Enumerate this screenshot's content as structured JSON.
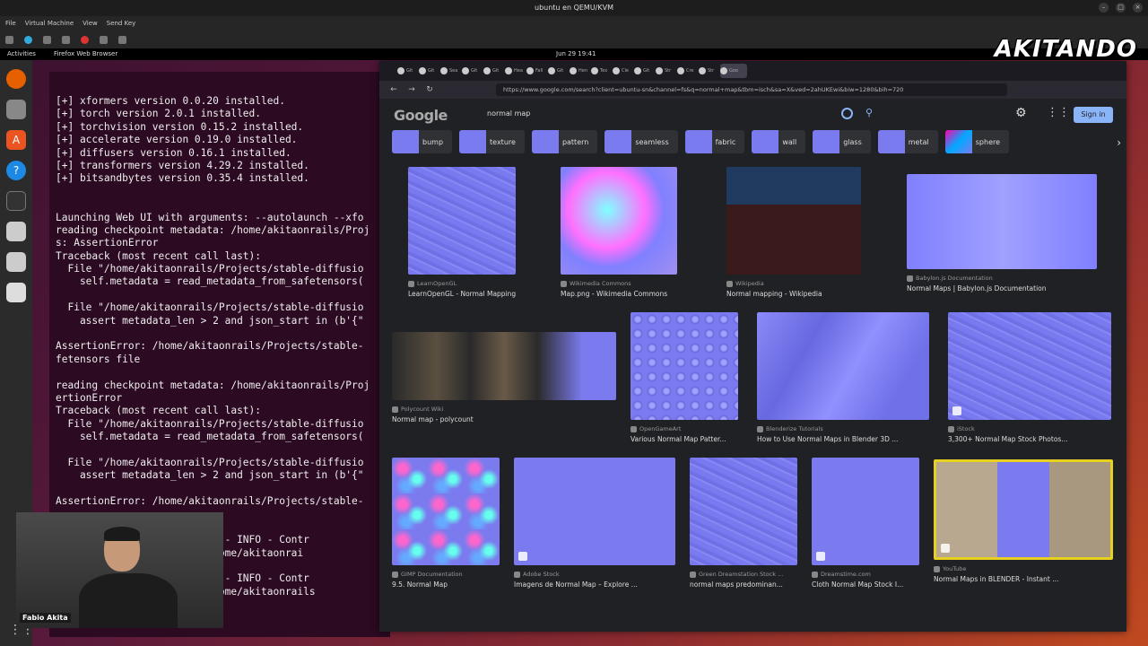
{
  "vm": {
    "title": "ubuntu en QEMU/KVM",
    "menu": [
      "File",
      "Virtual Machine",
      "View",
      "Send Key"
    ]
  },
  "topbar": {
    "activities": "Activities",
    "app": "Firefox Web Browser",
    "clock": "Jun 29  19:41"
  },
  "logo": "AKITANDO",
  "webcam": {
    "name": "Fabio Akita"
  },
  "terminal": {
    "lines": [
      "[+] xformers version 0.0.20 installed.",
      "[+] torch version 2.0.1 installed.",
      "[+] torchvision version 0.15.2 installed.",
      "[+] accelerate version 0.19.0 installed.",
      "[+] diffusers version 0.16.1 installed.",
      "[+] transformers version 4.29.2 installed.",
      "[+] bitsandbytes version 0.35.4 installed.",
      "",
      "",
      "Launching Web UI with arguments: --autolaunch --xfo",
      "reading checkpoint metadata: /home/akitaonrails/Proj",
      "s: AssertionError",
      "Traceback (most recent call last):",
      "  File \"/home/akitaonrails/Projects/stable-diffusio",
      "    self.metadata = read_metadata_from_safetensors(",
      "",
      "  File \"/home/akitaonrails/Projects/stable-diffusio",
      "    assert metadata_len > 2 and json_start in (b'{\"",
      "",
      "AssertionError: /home/akitaonrails/Projects/stable-",
      "fetensors file",
      "",
      "reading checkpoint metadata: /home/akitaonrails/Proj",
      "ertionError",
      "Traceback (most recent call last):",
      "  File \"/home/akitaonrails/Projects/stable-diffusio",
      "    self.metadata = read_metadata_from_safetensors(",
      "",
      "  File \"/home/akitaonrails/Projects/stable-diffusio",
      "    assert metadata_len > 2 and json_start in (b'{\"",
      "",
      "AssertionError: /home/akitaonrails/Projects/stable-",
      "",
      "",
      "                  ontrolNet - INFO - Contr",
      "                  ation: /home/akitaonrai",
      "",
      "                  ontrolNet - INFO - Contr",
      "                  ] from /home/akitaonrails"
    ]
  },
  "browser": {
    "url": "https://www.google.com/search?client=ubuntu-sn&channel=fs&q=normal+map&tbm=isch&sa=X&ved=2ahUKEwi&biw=1280&bih=720",
    "tabs": [
      "Git",
      "Git",
      "Sea",
      "Git",
      "Git",
      "Hea",
      "Fall",
      "Git",
      "Hen",
      "Tex",
      "Cle",
      "Git",
      "Str",
      "Cre",
      "Str",
      "Goo"
    ],
    "google": {
      "logo": "Google",
      "query": "normal map",
      "sign_in": "Sign in"
    },
    "chips": [
      "bump",
      "texture",
      "pattern",
      "seamless",
      "fabric",
      "wall",
      "glass",
      "metal",
      "sphere"
    ],
    "results": [
      {
        "source": "LearnOpenGL",
        "title": "LearnOpenGL - Normal Mapping"
      },
      {
        "source": "Wikimedia Commons",
        "title": "Map.png - Wikimedia Commons"
      },
      {
        "source": "Wikipedia",
        "title": "Normal mapping - Wikipedia"
      },
      {
        "source": "Babylon.js Documentation",
        "title": "Normal Maps | Babylon.js Documentation"
      },
      {
        "source": "Polycount Wiki",
        "title": "Normal map - polycount"
      },
      {
        "source": "OpenGameArt",
        "title": "Various Normal Map Patter..."
      },
      {
        "source": "Blenderize Tutorials",
        "title": "How to Use Normal Maps in Blender 3D ..."
      },
      {
        "source": "iStock",
        "title": "3,300+ Normal Map Stock Photos..."
      },
      {
        "source": "GIMP Documentation",
        "title": "9.5. Normal Map"
      },
      {
        "source": "Adobe Stock",
        "title": "Imagens de Normal Map – Explore ..."
      },
      {
        "source": "Green Dreamstation Stock ...",
        "title": "normal maps predominan..."
      },
      {
        "source": "Dreamstime.com",
        "title": "Cloth Normal Map Stock I..."
      },
      {
        "source": "YouTube",
        "title": "Normal Maps in BLENDER - Instant ..."
      }
    ]
  },
  "colors": {
    "terminal_bg": "#2c0a22",
    "normal_map_blue": "#7b7bef",
    "google_signin": "#8ab4f8"
  }
}
